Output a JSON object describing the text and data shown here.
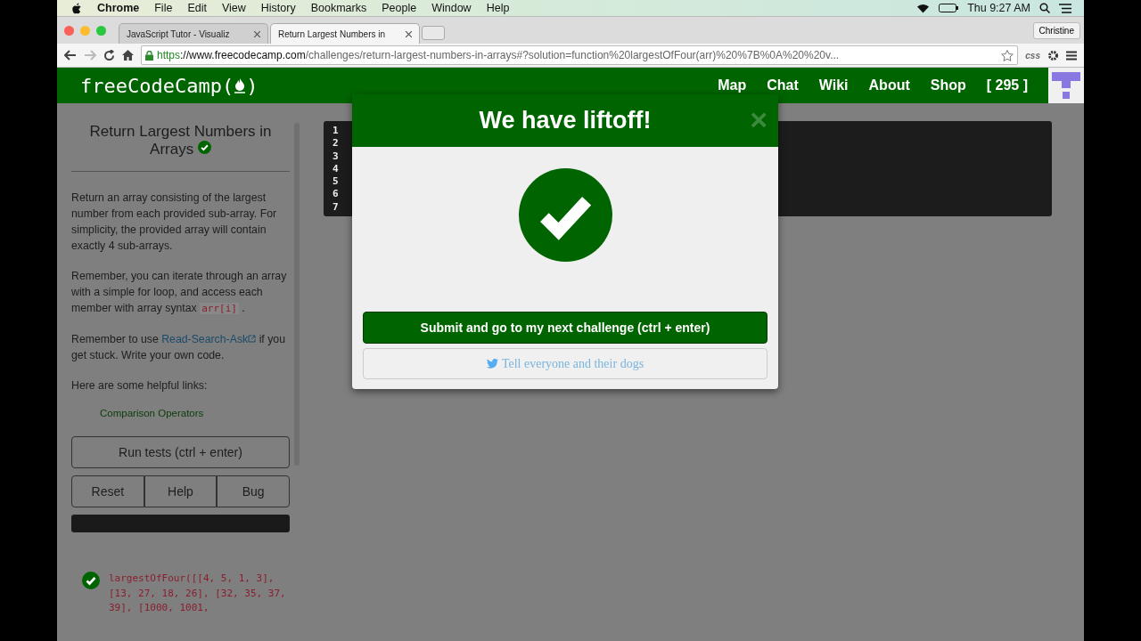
{
  "menubar": {
    "app": "Chrome",
    "menus": [
      "File",
      "Edit",
      "View",
      "History",
      "Bookmarks",
      "People",
      "Window",
      "Help"
    ],
    "clock": "Thu 9:27 AM"
  },
  "browser": {
    "tabs": [
      {
        "title": "JavaScript Tutor - Visualiz",
        "selected": false
      },
      {
        "title": "Return Largest Numbers in",
        "selected": true
      }
    ],
    "profile": "Christine",
    "url": {
      "scheme": "https",
      "host": "://www.freecodecamp.com",
      "path": "/challenges/return-largest-numbers-in-arrays#?solution=function%20largestOfFour(arr)%20%7B%0A%20%20v..."
    },
    "extensions": [
      {
        "kind": "text",
        "label": "css"
      }
    ]
  },
  "site": {
    "logo_start": "freeCodeCamp(",
    "logo_end": ")",
    "nav": [
      "Map",
      "Chat",
      "Wiki",
      "About",
      "Shop"
    ],
    "points": "[ 295 ]"
  },
  "challenge": {
    "title": "Return Largest Numbers in Arrays",
    "completed": true,
    "paragraphs": [
      [
        {
          "kind": "text",
          "text": "Return an array consisting of the largest number from each provided sub-array. For simplicity, the provided array will contain exactly 4 sub-arrays."
        }
      ],
      [
        {
          "kind": "text",
          "text": "Remember, you can iterate through an array with a simple for loop, and access each member with array syntax "
        },
        {
          "kind": "code",
          "text": "arr[i]"
        },
        {
          "kind": "text",
          "text": " ."
        }
      ],
      [
        {
          "kind": "text",
          "text": "Remember to use "
        },
        {
          "kind": "link",
          "text": "Read-Search-Ask"
        },
        {
          "kind": "text",
          "text": " if you get stuck. Write your own code."
        }
      ],
      [
        {
          "kind": "text",
          "text": "Here are some helpful links:"
        }
      ]
    ],
    "links": [
      "Comparison Operators"
    ],
    "run_button": "Run tests (ctrl + enter)",
    "buttons": [
      "Reset",
      "Help",
      "Bug"
    ],
    "tests": [
      {
        "passed": true,
        "code": "largestOfFour([[4, 5, 1, 3], [13, 27, 18, 26], [32, 35, 37, 39], [1000, 1001,"
      }
    ]
  },
  "editor": {
    "line_numbers": [
      "1",
      "2",
      "3",
      "4",
      "5",
      "6",
      "7"
    ]
  },
  "modal": {
    "title": "We have liftoff!",
    "close": "×",
    "submit": "Submit and go to my next challenge (ctrl + enter)",
    "share": "Tell everyone and their dogs"
  }
}
